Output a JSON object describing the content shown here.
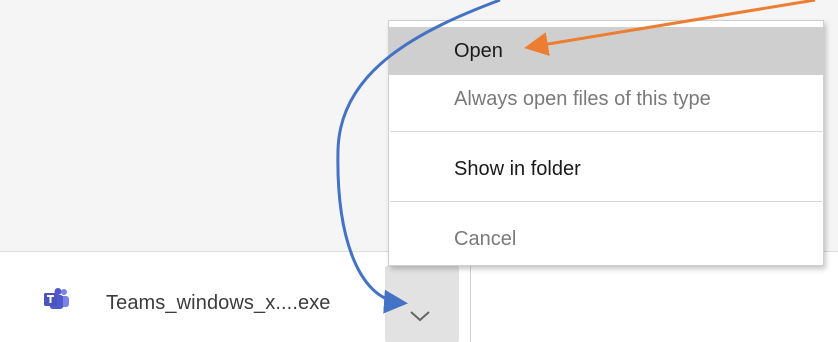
{
  "download_shelf": {
    "file_name": "Teams_windows_x....exe",
    "file_icon": "microsoft-teams-icon"
  },
  "context_menu": {
    "items": [
      {
        "label": "Open",
        "state": "highlighted"
      },
      {
        "label": "Always open files of this type",
        "state": "normal"
      },
      {
        "label": "Show in folder",
        "state": "normal"
      },
      {
        "label": "Cancel",
        "state": "normal"
      }
    ]
  },
  "annotations": {
    "blue_arrow_color": "#4472c4",
    "orange_arrow_color": "#ed7d31"
  },
  "colors": {
    "teams_purple": "#5059c9",
    "menu_highlight": "#cfcfcf"
  }
}
